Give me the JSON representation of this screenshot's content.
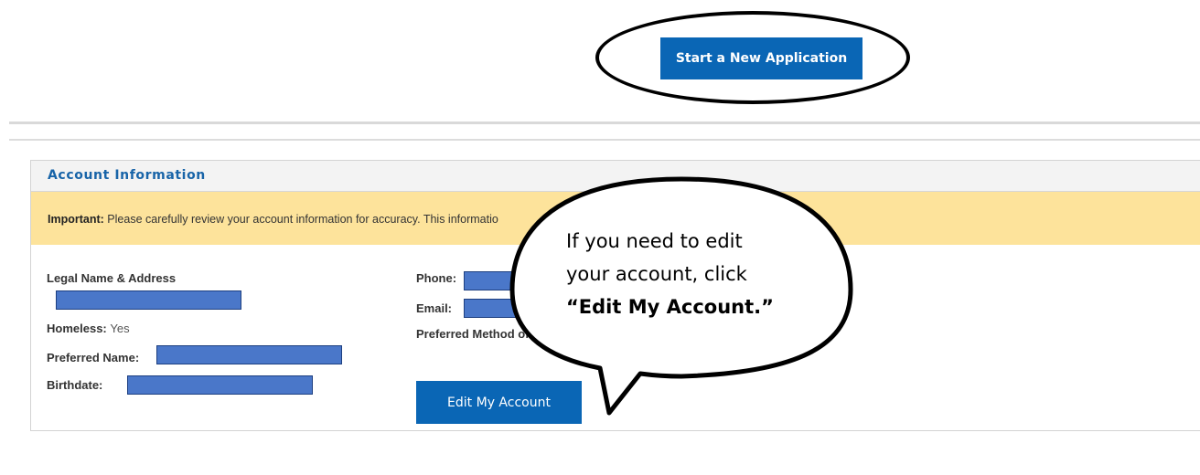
{
  "top": {
    "start_button_label": "Start a New Application"
  },
  "account": {
    "section_title": "Account Information",
    "notice_label": "Important:",
    "notice_text": "Please carefully review your account information for accuracy. This informatio",
    "legal_name_label": "Legal Name & Address",
    "homeless_label": "Homeless:",
    "homeless_value": "Yes",
    "preferred_name_label": "Preferred Name:",
    "birthdate_label": "Birthdate:",
    "phone_label": "Phone:",
    "email_label": "Email:",
    "preferred_method_label": "Preferred Method of",
    "edit_button_label": "Edit My Account"
  },
  "callout": {
    "line1": "If you need to edit",
    "line2": "your account, click",
    "line3": "“Edit My Account.”"
  },
  "colors": {
    "primary_button": "#0a66b5",
    "notice_bg": "#fde39b",
    "title_blue": "#1864a8",
    "redaction": "#4a77c9"
  }
}
